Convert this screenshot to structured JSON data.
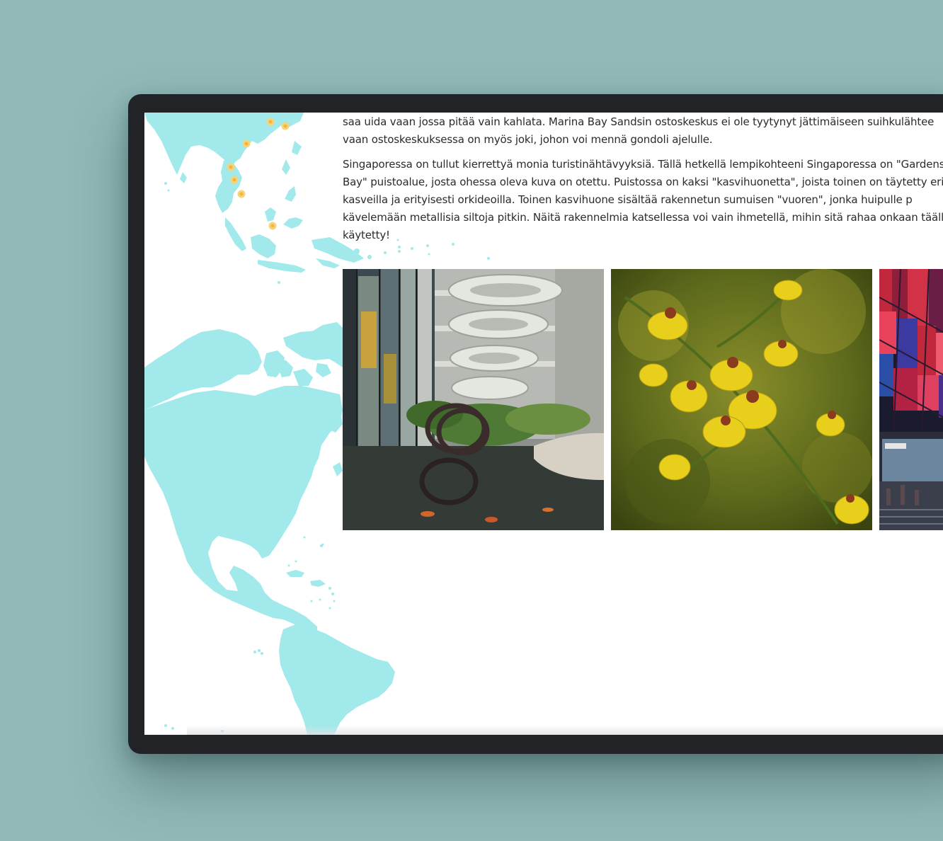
{
  "article": {
    "paragraph1_lines": [
      "saa uida vaan jossa pitää vain kahlata. Marina Bay Sandsin ostoskeskus ei ole tyytynyt jättimäiseen suihkulähtee",
      "vaan ostoskeskuksessa on myös joki, johon voi mennä gondoli ajelulle."
    ],
    "paragraph2_lines": [
      "Singaporessa on tullut kierrettyä monia turistinähtävyyksiä. Tällä hetkellä lempikohteeni Singaporessa on \"Gardens",
      "Bay\" puistoalue, josta ohessa oleva kuva on otettu. Puistossa on kaksi \"kasvihuonetta\", joista toinen on täytetty eril",
      "kasveilla ja erityisesti orkideoilla. Toinen kasvihuone sisältää rakennetun sumuisen \"vuoren\", jonka huipulle p",
      "kävelemään metallisia siltoja pitkin. Näitä rakennelmia katsellessa voi vain ihmetellä, mihin sitä rahaa onkaan täällä",
      "käytetty!"
    ]
  },
  "colors": {
    "background": "#92b9b8",
    "device_frame": "#222327",
    "map_land": "#a1e9ea",
    "map_marker": "#f2b63c",
    "text": "#2b2b2b"
  },
  "map": {
    "marker_count": 7
  },
  "gallery": {
    "photos": [
      "spiral-staircase-atrium-photo",
      "yellow-orchids-photo",
      "illuminated-mall-facade-photo"
    ]
  }
}
